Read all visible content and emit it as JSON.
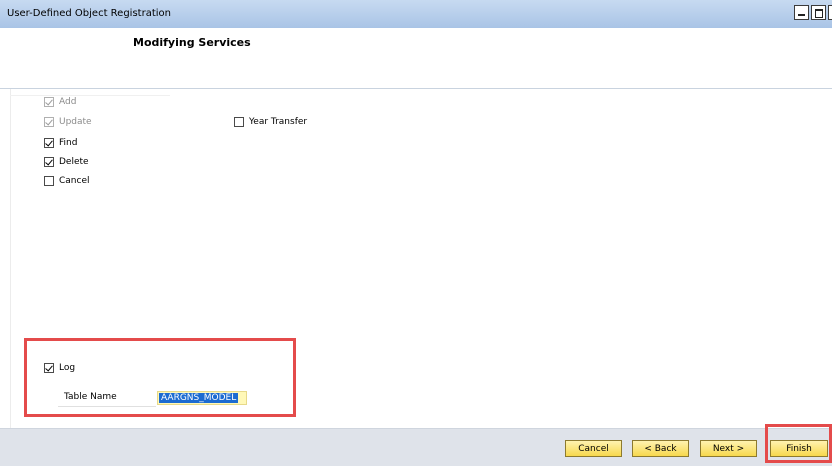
{
  "window": {
    "title": "User-Defined Object Registration"
  },
  "header": {
    "heading": "Modifying Services"
  },
  "services": [
    {
      "label": "Add",
      "checked": true,
      "disabled": true
    },
    {
      "label": "Update",
      "checked": true,
      "disabled": true
    },
    {
      "label": "Find",
      "checked": true,
      "disabled": false
    },
    {
      "label": "Delete",
      "checked": true,
      "disabled": false
    },
    {
      "label": "Cancel",
      "checked": false,
      "disabled": false
    }
  ],
  "year_transfer": {
    "label": "Year Transfer",
    "checked": false
  },
  "log": {
    "label": "Log",
    "checked": true
  },
  "table_name": {
    "label": "Table Name",
    "value": "AARGNS_MODEL"
  },
  "buttons": {
    "cancel": "Cancel",
    "back": "< Back",
    "next": "Next >",
    "finish": "Finish"
  },
  "colors": {
    "highlight": "#e44b4b",
    "button": "#f7d84d",
    "titlebar": "#b6cdea"
  }
}
